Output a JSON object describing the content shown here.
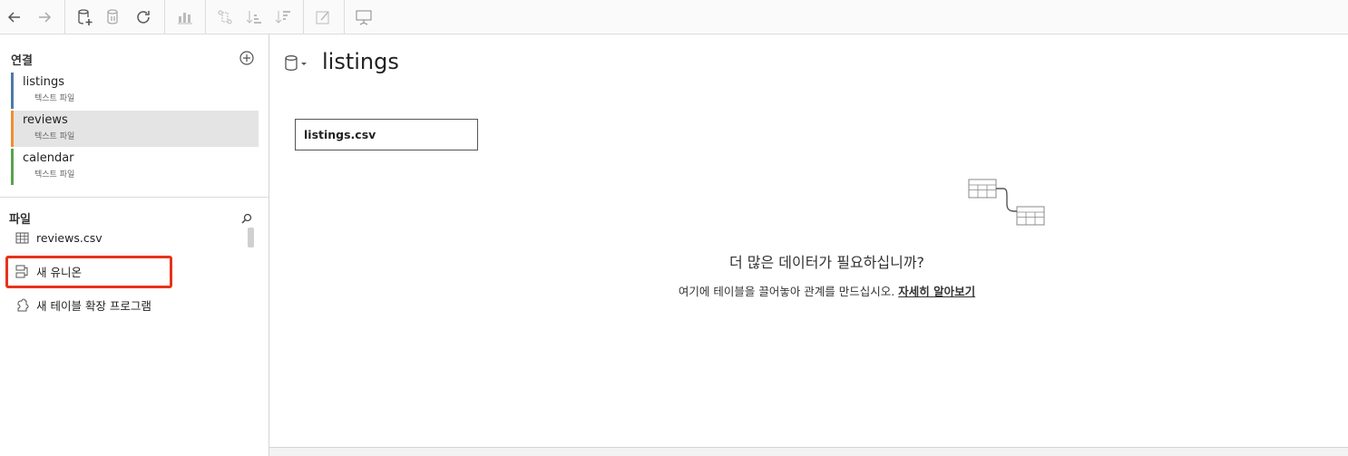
{
  "toolbar": {
    "buttons": [
      "back-icon",
      "forward-icon",
      "new-datasource-icon",
      "pause-updates-icon",
      "refresh-icon",
      "show-me-icon",
      "swap-icon",
      "sort-asc-icon",
      "sort-desc-icon",
      "highlight-icon",
      "presentation-icon"
    ]
  },
  "left_pane": {
    "connections_title": "연결",
    "connections": [
      {
        "name": "listings",
        "type": "텍스트 파일",
        "color": "#4e79a7"
      },
      {
        "name": "reviews",
        "type": "텍스트 파일",
        "color": "#f28e2b"
      },
      {
        "name": "calendar",
        "type": "텍스트 파일",
        "color": "#59a14f"
      }
    ],
    "files_title": "파일",
    "files": [
      {
        "label": "reviews.csv",
        "icon": "table-icon"
      },
      {
        "label": "새 유니온",
        "icon": "union-icon"
      },
      {
        "label": "새 테이블 확장 프로그램",
        "icon": "extension-icon"
      }
    ]
  },
  "main": {
    "datasource_title": "listings",
    "table_name": "listings.csv",
    "hint_title": "더 많은 데이터가 필요하십니까?",
    "hint_body": "여기에 테이블을 끌어놓아 관계를 만드십시오.",
    "hint_link": "자세히 알아보기"
  },
  "colors": {
    "annotation": "#e8331a"
  }
}
